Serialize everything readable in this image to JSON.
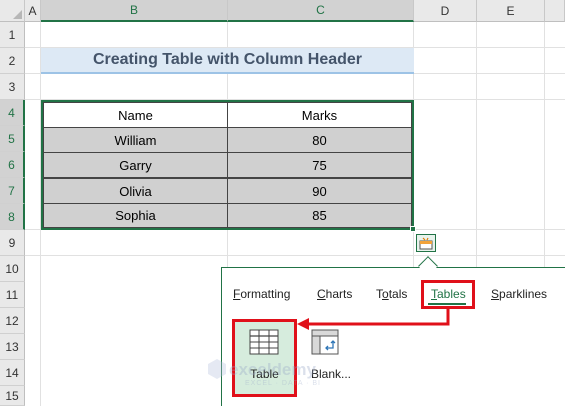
{
  "columns": [
    "A",
    "B",
    "C",
    "D",
    "E"
  ],
  "rows": [
    "1",
    "2",
    "3",
    "4",
    "5",
    "6",
    "7",
    "8",
    "9",
    "10",
    "11",
    "12",
    "13",
    "14",
    "15"
  ],
  "title": "Creating Table with Column Header",
  "table": {
    "headers": [
      "Name",
      "Marks"
    ],
    "rows": [
      [
        "William",
        "80"
      ],
      [
        "Garry",
        "75"
      ],
      [
        "Olivia",
        "90"
      ],
      [
        "Sophia",
        "85"
      ]
    ]
  },
  "quick_analysis": {
    "tabs": [
      {
        "pre": "",
        "u": "F",
        "post": "ormatting"
      },
      {
        "pre": "",
        "u": "C",
        "post": "harts"
      },
      {
        "pre": "T",
        "u": "o",
        "post": "tals"
      },
      {
        "pre": "",
        "u": "T",
        "post": "ables"
      },
      {
        "pre": "",
        "u": "S",
        "post": "parklines"
      }
    ],
    "active_tab": "Tables",
    "options": [
      "Table",
      "Blank..."
    ]
  },
  "watermark": {
    "main": "exceldemy",
    "sub": "EXCEL · DATA · BI"
  },
  "colors": {
    "accent": "#217346",
    "highlight": "#e0101a",
    "title_bg": "#dde9f5",
    "body_fill": "#d0d0d0"
  },
  "icons": [
    "quick-analysis-icon",
    "table-icon",
    "blank-pivot-icon"
  ]
}
